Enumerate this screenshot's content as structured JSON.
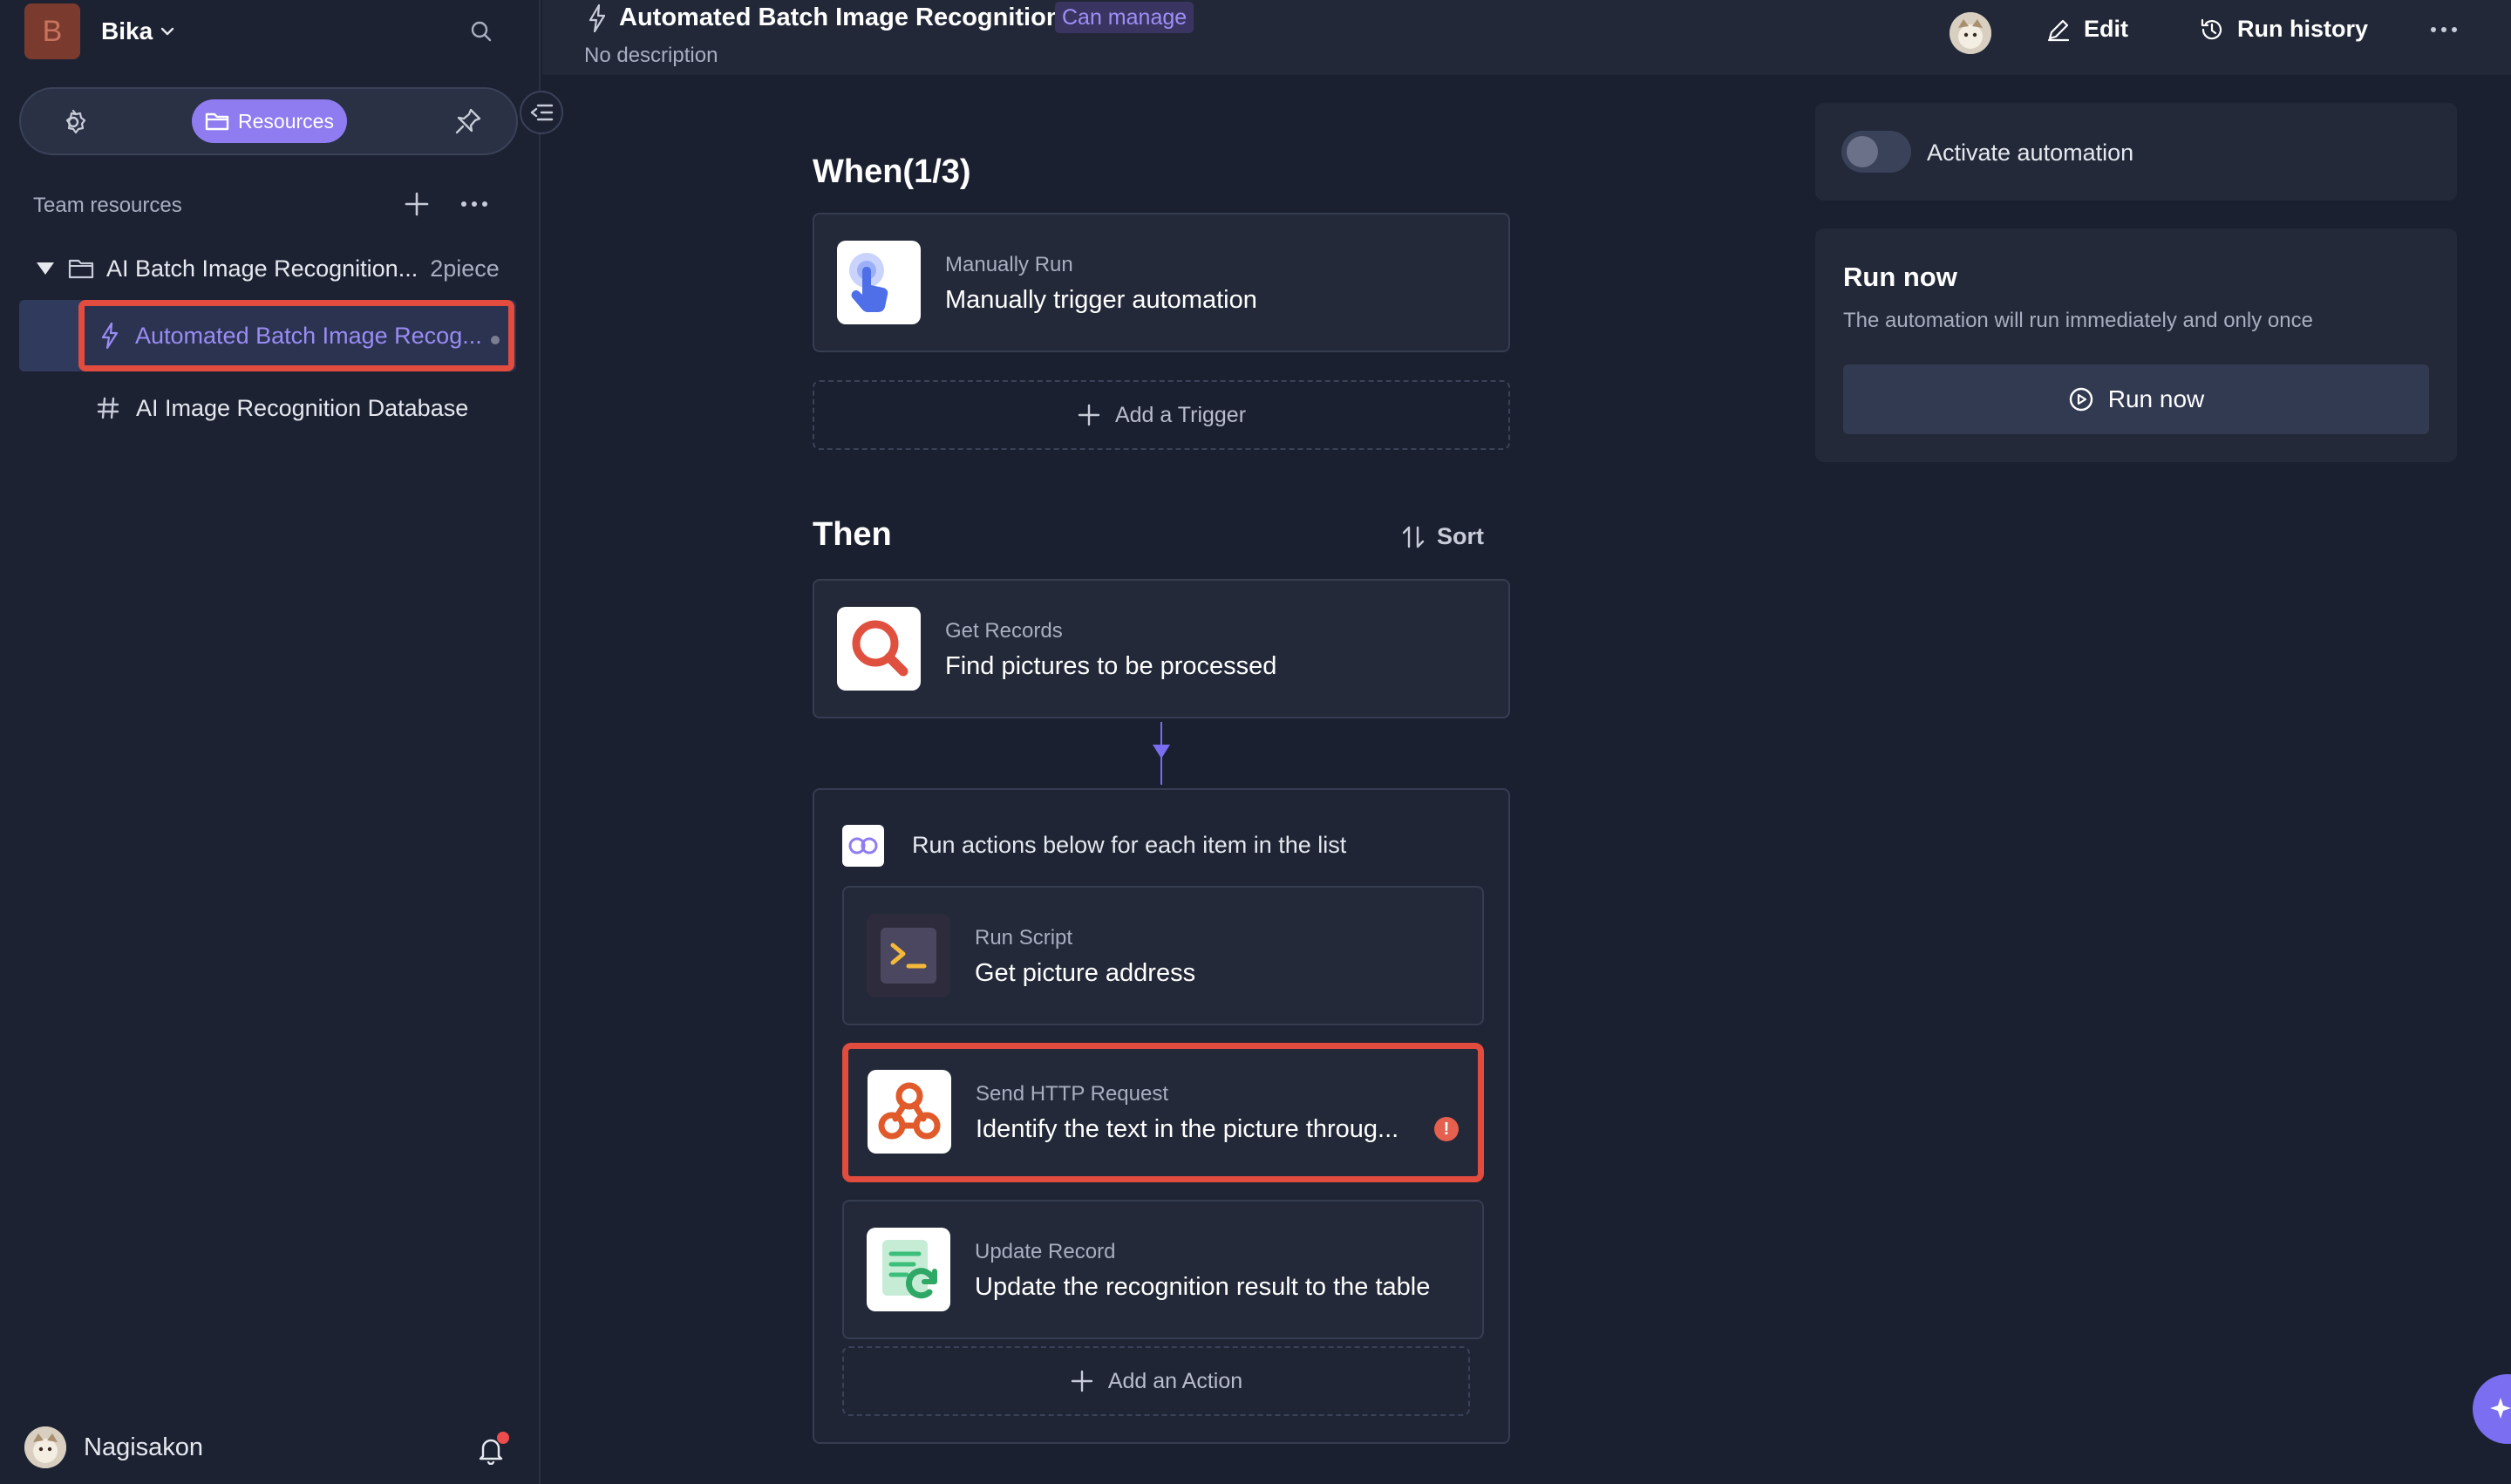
{
  "workspace": {
    "initial": "B",
    "name": "Bika"
  },
  "sidebar": {
    "tabs": {
      "resources_label": "Resources"
    },
    "team_resources_label": "Team resources",
    "folder": {
      "name": "AI Batch Image Recognition...",
      "count": "2piece"
    },
    "items": [
      {
        "label": "Automated Batch Image Recog...",
        "icon": "bolt-icon"
      },
      {
        "label": "AI Image Recognition Database",
        "icon": "hash-icon"
      }
    ],
    "user": {
      "name": "Nagisakon"
    }
  },
  "header": {
    "title": "Automated Batch Image Recognition",
    "badge": "Can manage",
    "description": "No description",
    "edit_label": "Edit",
    "history_label": "Run history"
  },
  "flow": {
    "when_title": "When(1/3)",
    "trigger": {
      "sub": "Manually Run",
      "main": "Manually trigger automation"
    },
    "add_trigger": "Add a Trigger",
    "then_title": "Then",
    "sort_label": "Sort",
    "get_records": {
      "sub": "Get Records",
      "main": "Find pictures to be processed"
    },
    "loop_label": "Run actions below for each item in the list",
    "run_script": {
      "sub": "Run Script",
      "main": "Get picture address"
    },
    "http_request": {
      "sub": "Send HTTP Request",
      "main": "Identify the text in the picture throug..."
    },
    "update_record": {
      "sub": "Update Record",
      "main": "Update the recognition result to the table"
    },
    "add_action": "Add an Action"
  },
  "right_panel": {
    "activate_label": "Activate automation",
    "activate_state": false,
    "run_title": "Run now",
    "run_desc": "The automation will run immediately and only once",
    "run_button": "Run now"
  },
  "colors": {
    "accent": "#8e7cf0",
    "highlight": "#e14c3f",
    "background": "#1b2030"
  }
}
